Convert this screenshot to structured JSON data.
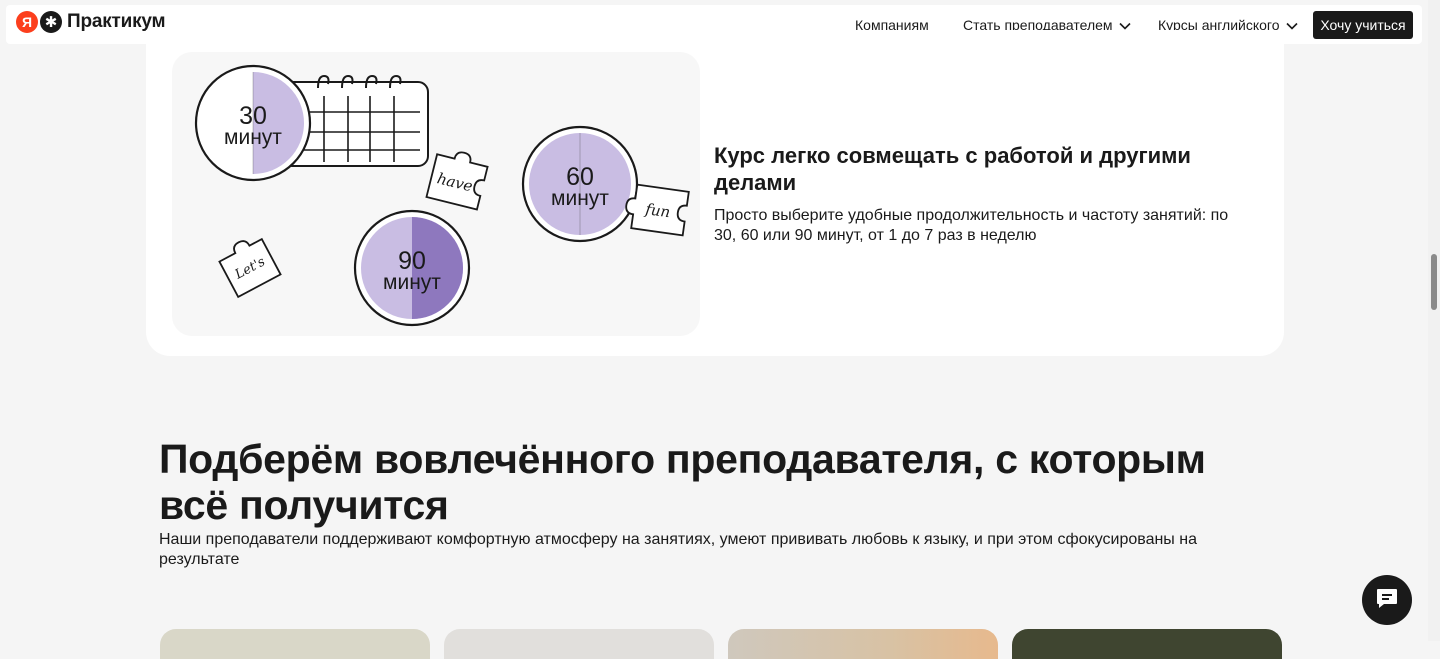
{
  "header": {
    "logo_ya": "Я",
    "logo_text": "Практикум",
    "nav": {
      "companies": "Компаниям",
      "teach": "Стать преподавателем",
      "courses": "Курсы английского"
    },
    "cta": "Хочу учиться"
  },
  "feature": {
    "illustration": {
      "dials": [
        {
          "value": "30",
          "unit": "минут"
        },
        {
          "value": "60",
          "unit": "минут"
        },
        {
          "value": "90",
          "unit": "минут"
        }
      ],
      "puzzles": [
        "have",
        "fun",
        "Let's"
      ]
    },
    "title": "Курс легко совмещать с работой и другими делами",
    "description": "Просто выберите удобные продолжительность и частоту занятий: по 30, 60 или 90 минут, от 1 до 7 раз в неделю"
  },
  "section": {
    "title": "Подберём вовлечённого преподавателя, с которым всё получится",
    "description": "Наши преподаватели поддерживают комфортную атмосферу на занятиях, умеют прививать любовь к языку, и при этом сфокусированы на результате"
  },
  "colors": {
    "brand_red": "#fc3f1d",
    "dark": "#1a1a1a",
    "lilac_light": "#c9bde3",
    "lilac_dark": "#8e78be"
  },
  "icons": {
    "chat": "chat-icon",
    "chevron": "chevron-down-icon"
  }
}
